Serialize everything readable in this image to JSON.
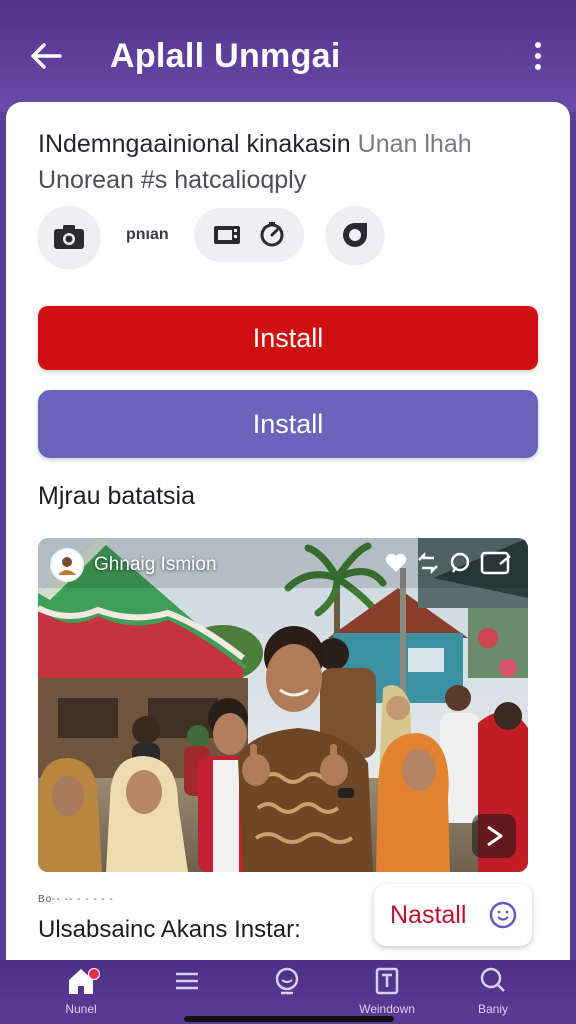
{
  "appbar": {
    "title": "Aplall Unmgai",
    "back_icon": "arrow-left-icon",
    "more_icon": "more-vertical-icon"
  },
  "content": {
    "headline_main": "INdemngaainional kinakasin",
    "headline_muted": " Unan lhah",
    "subline": "Unorean #s hatcalioqply",
    "pill_label": "pnıan",
    "install_primary_label": "Install",
    "install_secondary_label": "Install",
    "section_title": "Mjrau batatsia",
    "media": {
      "user_name": "Ghnaig Ismion"
    },
    "caption_small": "Bo-- -- - - - - -",
    "caption": "Ulsabsainc Akans Instar:",
    "nastall_label": "Nastall"
  },
  "bottom_nav": {
    "items": [
      {
        "label": "Nunel",
        "icon": "home-icon",
        "active": true
      },
      {
        "label": "",
        "icon": "menu-icon"
      },
      {
        "label": "",
        "icon": "assistant-icon"
      },
      {
        "label": "Weindown",
        "icon": "document-icon"
      },
      {
        "label": "Baniy",
        "icon": "chat-search-icon"
      }
    ]
  },
  "colors": {
    "appbar": "#52338d",
    "install_primary": "#cf0f10",
    "install_secondary": "#6a64bc",
    "nastall_text": "#c0102e"
  }
}
